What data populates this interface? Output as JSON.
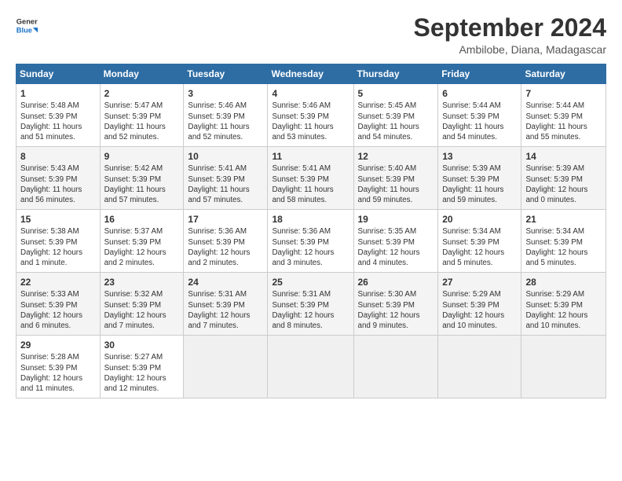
{
  "header": {
    "logo_line1": "General",
    "logo_line2": "Blue",
    "month": "September 2024",
    "location": "Ambilobe, Diana, Madagascar"
  },
  "weekdays": [
    "Sunday",
    "Monday",
    "Tuesday",
    "Wednesday",
    "Thursday",
    "Friday",
    "Saturday"
  ],
  "weeks": [
    [
      {
        "day": "1",
        "info": "Sunrise: 5:48 AM\nSunset: 5:39 PM\nDaylight: 11 hours\nand 51 minutes."
      },
      {
        "day": "2",
        "info": "Sunrise: 5:47 AM\nSunset: 5:39 PM\nDaylight: 11 hours\nand 52 minutes."
      },
      {
        "day": "3",
        "info": "Sunrise: 5:46 AM\nSunset: 5:39 PM\nDaylight: 11 hours\nand 52 minutes."
      },
      {
        "day": "4",
        "info": "Sunrise: 5:46 AM\nSunset: 5:39 PM\nDaylight: 11 hours\nand 53 minutes."
      },
      {
        "day": "5",
        "info": "Sunrise: 5:45 AM\nSunset: 5:39 PM\nDaylight: 11 hours\nand 54 minutes."
      },
      {
        "day": "6",
        "info": "Sunrise: 5:44 AM\nSunset: 5:39 PM\nDaylight: 11 hours\nand 54 minutes."
      },
      {
        "day": "7",
        "info": "Sunrise: 5:44 AM\nSunset: 5:39 PM\nDaylight: 11 hours\nand 55 minutes."
      }
    ],
    [
      {
        "day": "8",
        "info": "Sunrise: 5:43 AM\nSunset: 5:39 PM\nDaylight: 11 hours\nand 56 minutes."
      },
      {
        "day": "9",
        "info": "Sunrise: 5:42 AM\nSunset: 5:39 PM\nDaylight: 11 hours\nand 57 minutes."
      },
      {
        "day": "10",
        "info": "Sunrise: 5:41 AM\nSunset: 5:39 PM\nDaylight: 11 hours\nand 57 minutes."
      },
      {
        "day": "11",
        "info": "Sunrise: 5:41 AM\nSunset: 5:39 PM\nDaylight: 11 hours\nand 58 minutes."
      },
      {
        "day": "12",
        "info": "Sunrise: 5:40 AM\nSunset: 5:39 PM\nDaylight: 11 hours\nand 59 minutes."
      },
      {
        "day": "13",
        "info": "Sunrise: 5:39 AM\nSunset: 5:39 PM\nDaylight: 11 hours\nand 59 minutes."
      },
      {
        "day": "14",
        "info": "Sunrise: 5:39 AM\nSunset: 5:39 PM\nDaylight: 12 hours\nand 0 minutes."
      }
    ],
    [
      {
        "day": "15",
        "info": "Sunrise: 5:38 AM\nSunset: 5:39 PM\nDaylight: 12 hours\nand 1 minute."
      },
      {
        "day": "16",
        "info": "Sunrise: 5:37 AM\nSunset: 5:39 PM\nDaylight: 12 hours\nand 2 minutes."
      },
      {
        "day": "17",
        "info": "Sunrise: 5:36 AM\nSunset: 5:39 PM\nDaylight: 12 hours\nand 2 minutes."
      },
      {
        "day": "18",
        "info": "Sunrise: 5:36 AM\nSunset: 5:39 PM\nDaylight: 12 hours\nand 3 minutes."
      },
      {
        "day": "19",
        "info": "Sunrise: 5:35 AM\nSunset: 5:39 PM\nDaylight: 12 hours\nand 4 minutes."
      },
      {
        "day": "20",
        "info": "Sunrise: 5:34 AM\nSunset: 5:39 PM\nDaylight: 12 hours\nand 5 minutes."
      },
      {
        "day": "21",
        "info": "Sunrise: 5:34 AM\nSunset: 5:39 PM\nDaylight: 12 hours\nand 5 minutes."
      }
    ],
    [
      {
        "day": "22",
        "info": "Sunrise: 5:33 AM\nSunset: 5:39 PM\nDaylight: 12 hours\nand 6 minutes."
      },
      {
        "day": "23",
        "info": "Sunrise: 5:32 AM\nSunset: 5:39 PM\nDaylight: 12 hours\nand 7 minutes."
      },
      {
        "day": "24",
        "info": "Sunrise: 5:31 AM\nSunset: 5:39 PM\nDaylight: 12 hours\nand 7 minutes."
      },
      {
        "day": "25",
        "info": "Sunrise: 5:31 AM\nSunset: 5:39 PM\nDaylight: 12 hours\nand 8 minutes."
      },
      {
        "day": "26",
        "info": "Sunrise: 5:30 AM\nSunset: 5:39 PM\nDaylight: 12 hours\nand 9 minutes."
      },
      {
        "day": "27",
        "info": "Sunrise: 5:29 AM\nSunset: 5:39 PM\nDaylight: 12 hours\nand 10 minutes."
      },
      {
        "day": "28",
        "info": "Sunrise: 5:29 AM\nSunset: 5:39 PM\nDaylight: 12 hours\nand 10 minutes."
      }
    ],
    [
      {
        "day": "29",
        "info": "Sunrise: 5:28 AM\nSunset: 5:39 PM\nDaylight: 12 hours\nand 11 minutes."
      },
      {
        "day": "30",
        "info": "Sunrise: 5:27 AM\nSunset: 5:39 PM\nDaylight: 12 hours\nand 12 minutes."
      },
      null,
      null,
      null,
      null,
      null
    ]
  ]
}
